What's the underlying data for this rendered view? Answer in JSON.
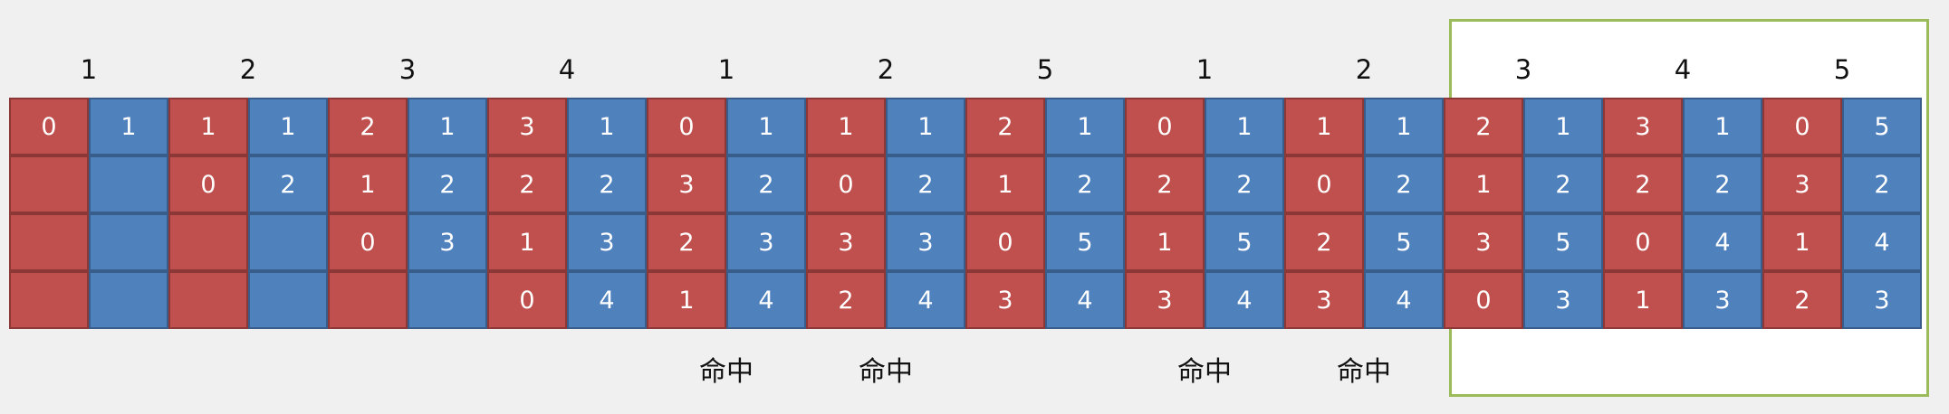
{
  "colors": {
    "page_frame_red": "#c0504d",
    "page_number_blue": "#4f81bd",
    "highlight_green": "#9bbb59"
  },
  "reference_string": [
    "1",
    "2",
    "3",
    "4",
    "1",
    "2",
    "5",
    "1",
    "2",
    "3",
    "4",
    "5"
  ],
  "steps": [
    {
      "frames": [
        "0",
        "",
        "",
        ""
      ],
      "pages": [
        "1",
        "",
        "",
        ""
      ]
    },
    {
      "frames": [
        "1",
        "0",
        "",
        ""
      ],
      "pages": [
        "1",
        "2",
        "",
        ""
      ]
    },
    {
      "frames": [
        "2",
        "1",
        "0",
        ""
      ],
      "pages": [
        "1",
        "2",
        "3",
        ""
      ]
    },
    {
      "frames": [
        "3",
        "2",
        "1",
        "0"
      ],
      "pages": [
        "1",
        "2",
        "3",
        "4"
      ]
    },
    {
      "frames": [
        "0",
        "3",
        "2",
        "1"
      ],
      "pages": [
        "1",
        "2",
        "3",
        "4"
      ]
    },
    {
      "frames": [
        "1",
        "0",
        "3",
        "2"
      ],
      "pages": [
        "1",
        "2",
        "3",
        "4"
      ]
    },
    {
      "frames": [
        "2",
        "1",
        "0",
        "3"
      ],
      "pages": [
        "1",
        "2",
        "5",
        "4"
      ]
    },
    {
      "frames": [
        "0",
        "2",
        "1",
        "3"
      ],
      "pages": [
        "1",
        "2",
        "5",
        "4"
      ]
    },
    {
      "frames": [
        "1",
        "0",
        "2",
        "3"
      ],
      "pages": [
        "1",
        "2",
        "5",
        "4"
      ]
    },
    {
      "frames": [
        "2",
        "1",
        "3",
        "0"
      ],
      "pages": [
        "1",
        "2",
        "5",
        "3"
      ]
    },
    {
      "frames": [
        "3",
        "2",
        "0",
        "1"
      ],
      "pages": [
        "1",
        "2",
        "4",
        "3"
      ]
    },
    {
      "frames": [
        "0",
        "3",
        "1",
        "2"
      ],
      "pages": [
        "5",
        "2",
        "4",
        "3"
      ]
    }
  ],
  "hit_label": "命中",
  "hit_steps": [
    4,
    5,
    7,
    8
  ]
}
